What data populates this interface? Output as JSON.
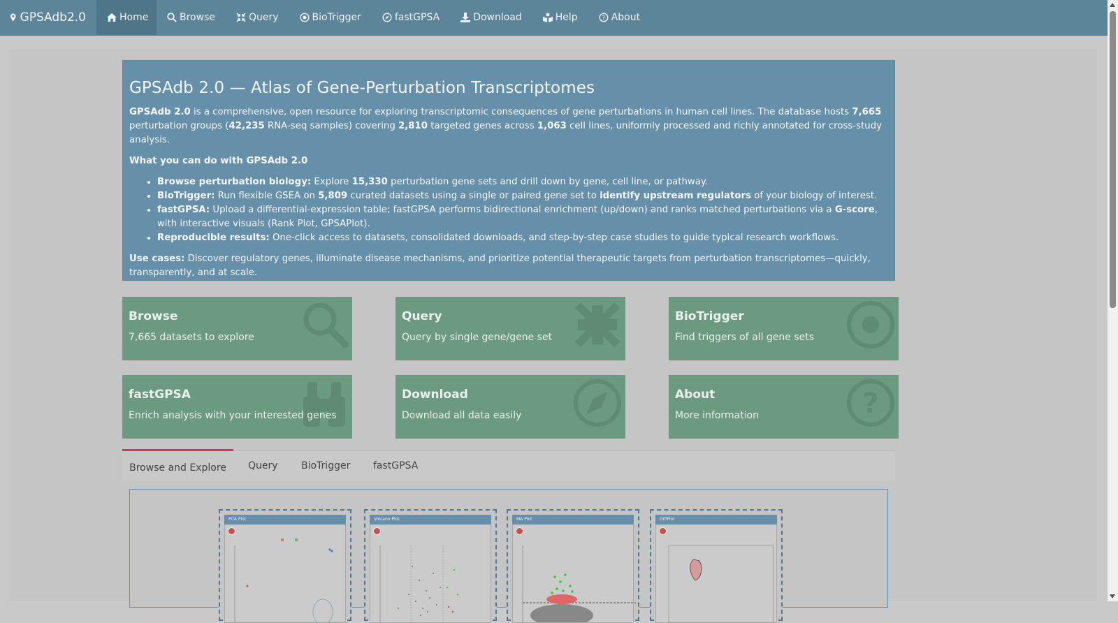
{
  "brand": {
    "name": "GPSAdb2.0"
  },
  "nav": [
    {
      "label": "Home",
      "icon": "home-icon",
      "active": true
    },
    {
      "label": "Browse",
      "icon": "search-icon"
    },
    {
      "label": "Query",
      "icon": "compress-icon"
    },
    {
      "label": "BioTrigger",
      "icon": "dot-circle-icon"
    },
    {
      "label": "fastGPSA",
      "icon": "compass-icon"
    },
    {
      "label": "Download",
      "icon": "download-icon"
    },
    {
      "label": "Help",
      "icon": "book-reader-icon"
    },
    {
      "label": "About",
      "icon": "question-circle-icon"
    }
  ],
  "jumbotron": {
    "title": "GPSAdb 2.0 — Atlas of Gene-Perturbation Transcriptomes",
    "intro": {
      "name": "GPSAdb 2.0",
      "t1": " is a comprehensive, open resource for exploring transcriptomic consequences of gene perturbations in human cell lines. The database hosts ",
      "n1": "7,665",
      "t2": " perturbation groups (",
      "n2": "42,235",
      "t3": " RNA-seq samples) covering ",
      "n3": "2,810",
      "t4": " targeted genes across ",
      "n4": "1,063",
      "t5": " cell lines, uniformly processed and richly annotated for cross-study analysis."
    },
    "what_heading": "What you can do with GPSAdb 2.0",
    "bullets": {
      "b1_label": "Browse perturbation biology:",
      "b1_t1": " Explore ",
      "b1_n": "15,330",
      "b1_t2": " perturbation gene sets and drill down by gene, cell line, or pathway.",
      "b2_label": "BioTrigger:",
      "b2_t1": " Run flexible GSEA on ",
      "b2_n": "5,809",
      "b2_t2": " curated datasets using a single or paired gene set to ",
      "b2_bold": "identify upstream regulators",
      "b2_t3": " of your biology of interest.",
      "b3_label": "fastGPSA:",
      "b3_t1": " Upload a differential-expression table; fastGPSA performs bidirectional enrichment (up/down) and ranks matched perturbations via a ",
      "b3_bold": "G-score",
      "b3_t2": ", with interactive visuals (Rank Plot, GPSAPlot).",
      "b4_label": "Reproducible results:",
      "b4_t1": " One-click access to datasets, consolidated downloads, and step-by-step case studies to guide typical research workflows."
    },
    "use_cases": {
      "label": "Use cases:",
      "text": " Discover regulatory genes, illuminate disease mechanisms, and prioritize potential therapeutic targets from perturbation transcriptomes—quickly, transparently, and at scale."
    }
  },
  "tiles": [
    {
      "title": "Browse",
      "desc": "7,665 datasets to explore",
      "icon": "search-icon"
    },
    {
      "title": "Query",
      "desc": "Query by single gene/gene set",
      "icon": "compress-icon"
    },
    {
      "title": "BioTrigger",
      "desc": "Find triggers of all gene sets",
      "icon": "dot-circle-icon"
    },
    {
      "title": "fastGPSA",
      "desc": "Enrich analysis with your interested genes",
      "icon": "binoculars-icon"
    },
    {
      "title": "Download",
      "desc": "Download all data easily",
      "icon": "compass-icon"
    },
    {
      "title": "About",
      "desc": "More information",
      "icon": "question-circle-icon"
    }
  ],
  "tabs": [
    {
      "label": "Browse and Explore",
      "active": true
    },
    {
      "label": "Query"
    },
    {
      "label": "BioTrigger"
    },
    {
      "label": "fastGPSA"
    }
  ],
  "previews": [
    {
      "title": "PCA Plot"
    },
    {
      "title": "Volcano Plot"
    },
    {
      "title": "MA Plot"
    },
    {
      "title": "DiffPlot"
    }
  ],
  "colors": {
    "navbar": "#5d8599",
    "jumbotron": "#6690a9",
    "tile": "#6b9a80",
    "tab_accent": "#c0463f"
  }
}
